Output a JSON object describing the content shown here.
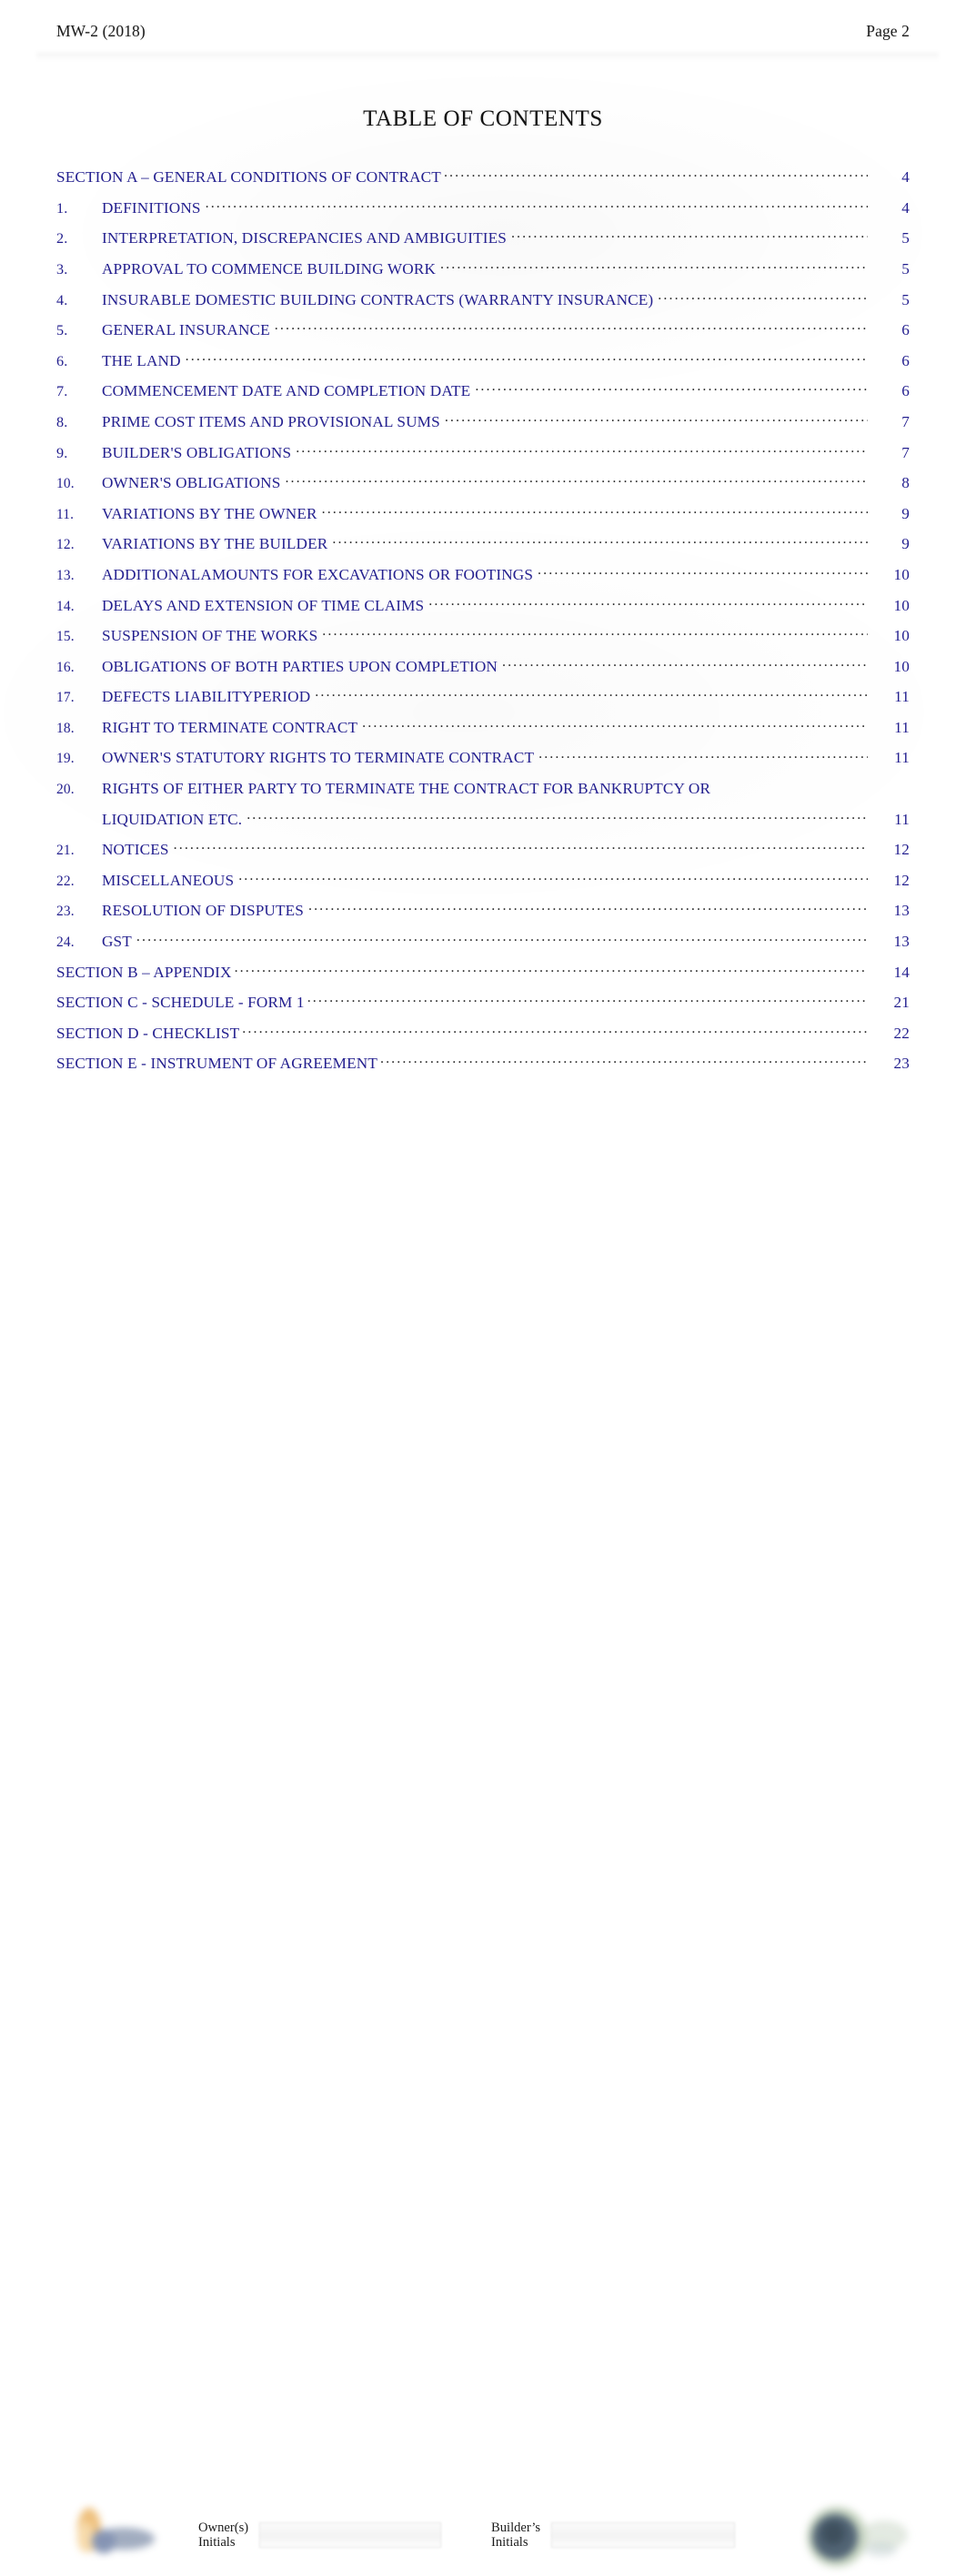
{
  "header": {
    "doc_code": "MW-2 (2018)",
    "page_label": "Page 2"
  },
  "title": "TABLE OF CONTENTS",
  "toc": {
    "entries": [
      {
        "num": "",
        "label": "SECTION  A – GENERAL  CONDITIONS  OF CONTRACT",
        "page": "4",
        "type": "section"
      },
      {
        "num": "1.",
        "label": "DEFINITIONS",
        "page": "4",
        "type": "item"
      },
      {
        "num": "2.",
        "label": "INTERPRETATION,   DISCREPANCIES   AND AMBIGUITIES",
        "page": "5",
        "type": "item"
      },
      {
        "num": "3.",
        "label": "APPROVAL  TO COMMENCE  BUILDING WORK",
        "page": "5",
        "type": "item"
      },
      {
        "num": "4.",
        "label": "INSURABLE DOMESTIC  BUILDING CONTRACTS  (WARRANTY  INSURANCE)",
        "page": "5",
        "type": "item"
      },
      {
        "num": "5.",
        "label": "GENERAL  INSURANCE",
        "page": "6",
        "type": "item"
      },
      {
        "num": "6.",
        "label": "THE  LAND",
        "page": "6",
        "type": "item"
      },
      {
        "num": "7.",
        "label": "COMMENCEMENT  DATE  AND COMPLETION  DATE",
        "page": "6",
        "type": "item"
      },
      {
        "num": "8.",
        "label": "PRIME  COST  ITEMS AND PROVISIONAL  SUMS",
        "page": "7",
        "type": "item"
      },
      {
        "num": "9.",
        "label": "BUILDER'S  OBLIGATIONS",
        "page": "7",
        "type": "item"
      },
      {
        "num": "10.",
        "label": "OWNER'S  OBLIGATIONS",
        "page": "8",
        "type": "item"
      },
      {
        "num": "11.",
        "label": "VARIATIONS  BY THE OWNER",
        "page": "9",
        "type": "item"
      },
      {
        "num": "12.",
        "label": "VARIATIONS  BY THE BUILDER",
        "page": "9",
        "type": "item"
      },
      {
        "num": "13.",
        "label": "ADDITIONALAMOUNTS  FOR  EXCAVATIONS   OR  FOOTINGS",
        "page": "10",
        "type": "item"
      },
      {
        "num": "14.",
        "label": "DELAYS  AND EXTENSION  OF  TIME CLAIMS",
        "page": "10",
        "type": "item"
      },
      {
        "num": "15.",
        "label": "SUSPENSION   OF  THE WORKS",
        "page": "10",
        "type": "item"
      },
      {
        "num": "16.",
        "label": "OBLIGATIONS  OF  BOTH PARTIES   UPON  COMPLETION",
        "page": "10",
        "type": "item"
      },
      {
        "num": "17.",
        "label": "DEFECTS  LIABILITYPERIOD",
        "page": "11",
        "type": "item"
      },
      {
        "num": "18.",
        "label": "RIGHT TO  TERMINATE  CONTRACT",
        "page": "11",
        "type": "item"
      },
      {
        "num": "19.",
        "label": "OWNER'S  STATUTORY   RIGHTS  TO  TERMINATE CONTRACT",
        "page": "11",
        "type": "item"
      },
      {
        "num": "20.",
        "label": "RIGHTS  OF EITHER  PARTY  TO TERMINATE  THE  CONTRACT  FOR  BANKRUPTCY  OR",
        "page": "",
        "type": "item-nodots"
      },
      {
        "num": "",
        "label": "LIQUIDATION ETC.",
        "page": "11",
        "type": "continuation"
      },
      {
        "num": "21.",
        "label": "NOTICES",
        "page": "12",
        "type": "item"
      },
      {
        "num": "22.",
        "label": "MISCELLANEOUS",
        "page": "12",
        "type": "item"
      },
      {
        "num": "23.",
        "label": "RESOLUTION  OF  DISPUTES",
        "page": "13",
        "type": "item"
      },
      {
        "num": "24.",
        "label": "GST",
        "page": "13",
        "type": "item"
      },
      {
        "num": "",
        "label": "SECTION  B – APPENDIX",
        "page": "14",
        "type": "section"
      },
      {
        "num": "",
        "label": "SECTION  C - SCHEDULE  - FORM  1",
        "page": "21",
        "type": "section"
      },
      {
        "num": "",
        "label": "SECTION  D - CHECKLIST",
        "page": "22",
        "type": "section"
      },
      {
        "num": "",
        "label": "SECTION  E - INSTRUMENT  OF  AGREEMENT",
        "page": "23",
        "type": "section"
      }
    ]
  },
  "footer": {
    "owner_initials_label": "Owner(s)\nInitials",
    "builder_initials_label": "Builder’s\nInitials",
    "owner_initials_value": "",
    "builder_initials_value": ""
  },
  "colors": {
    "toc_text": "#231f8f",
    "header_text": "#1a1a1a",
    "title_text": "#111111",
    "logo_left_accent": "#e8b86a",
    "logo_left_secondary": "#8e9cb5",
    "logo_right_accent": "#8aa37f",
    "logo_right_secondary": "#3c4f5c"
  }
}
